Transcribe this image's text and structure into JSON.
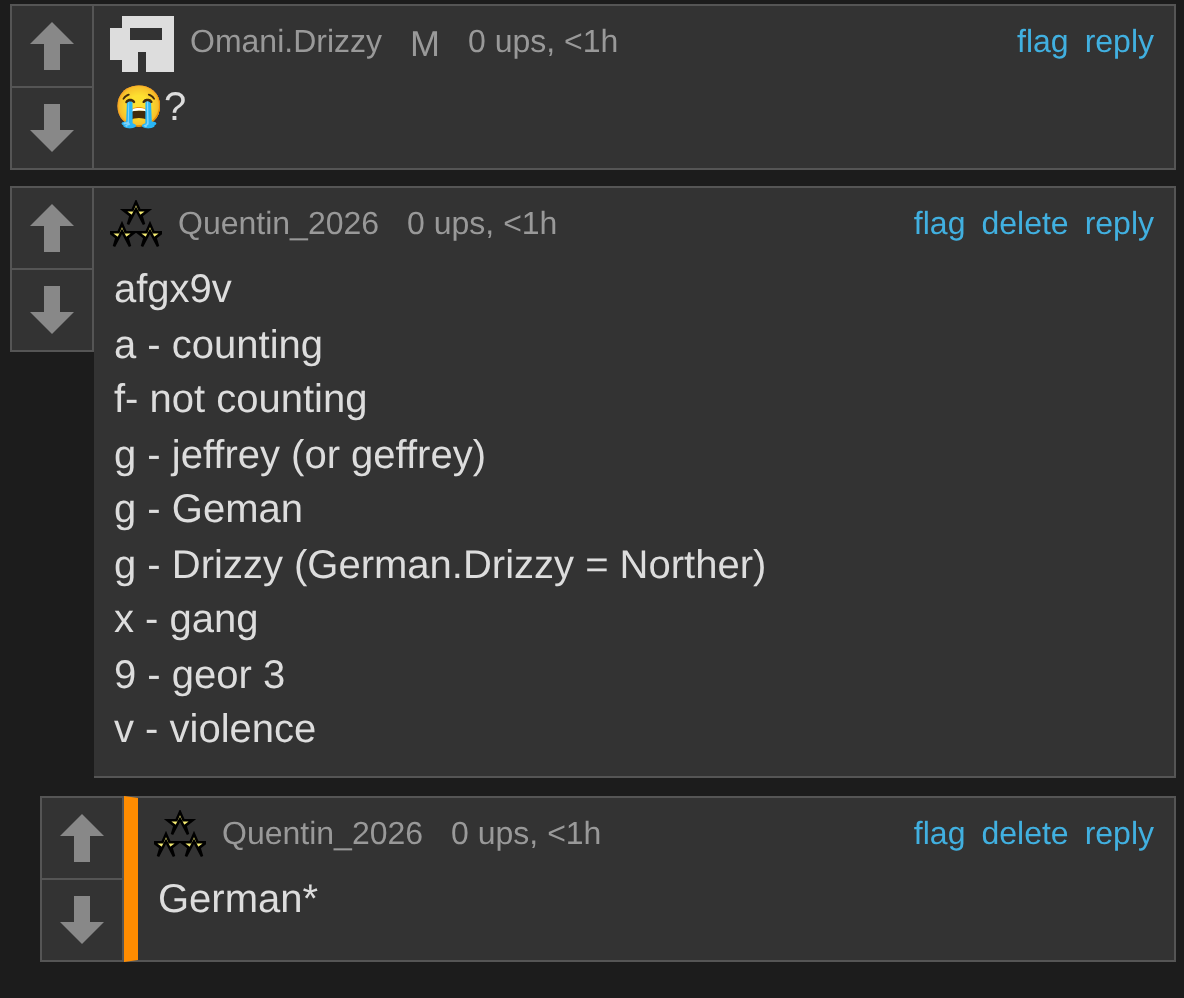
{
  "comments": [
    {
      "kind": "blocky",
      "user": "Omani.Drizzy",
      "badge": "M",
      "meta": "0 ups, <1h",
      "actions": [
        "flag",
        "reply"
      ],
      "highlighted": false,
      "lines": [
        "😭?"
      ]
    },
    {
      "kind": "stars",
      "user": "Quentin_2026",
      "meta": "0 ups, <1h",
      "actions": [
        "flag",
        "delete",
        "reply"
      ],
      "highlighted": false,
      "lines": [
        "afgx9v",
        "a - counting",
        "f- not counting",
        "g - jeffrey (or geffrey)",
        "g - Geman",
        "g - Drizzy (German.Drizzy = Norther)",
        "x - gang",
        "9 - geor 3",
        "v - violence"
      ],
      "children": [
        {
          "kind": "stars",
          "user": "Quentin_2026",
          "meta": "0 ups, <1h",
          "actions": [
            "flag",
            "delete",
            "reply"
          ],
          "highlighted": true,
          "lines": [
            "German*"
          ]
        }
      ]
    }
  ]
}
